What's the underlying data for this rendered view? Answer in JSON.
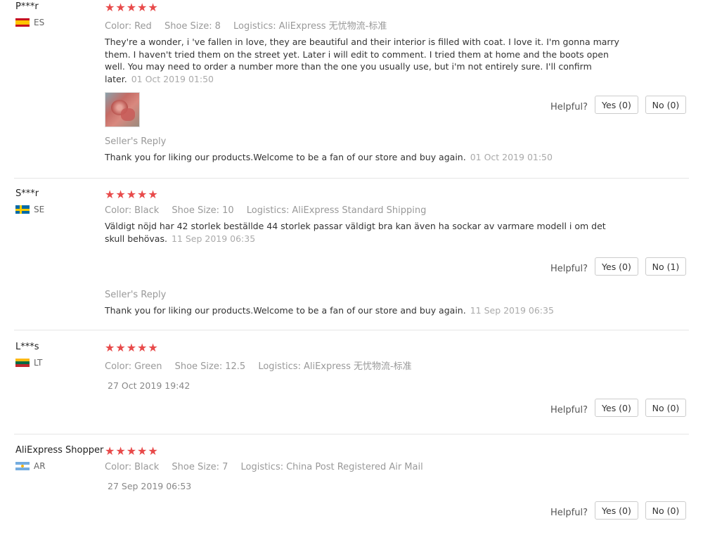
{
  "labels": {
    "color": "Color:",
    "shoe_size": "Shoe Size:",
    "logistics": "Logistics:",
    "helpful": "Helpful?",
    "seller_reply": "Seller's Reply"
  },
  "reviews": [
    {
      "user": "P***r",
      "country": "ES",
      "stars": "★★★★★",
      "color": "Red",
      "shoe_size": "8",
      "logistics": "AliExpress 无忧物流-标准",
      "text": "They're a wonder, i 've fallen in love, they are beautiful and their interior is filled with coat. I love it. I'm gonna marry them. I haven't tried them on the street yet. Later i will edit to comment. I tried them at home and the boots open well. You may need to order a number more than the one you usually use, but i'm not entirely sure. I'll confirm later.",
      "date": "01 Oct 2019 01:50",
      "yes": "Yes (0)",
      "no": "No (0)",
      "reply_text": "Thank you for liking our products.Welcome to be a fan of our store and buy again.",
      "reply_date": "01 Oct 2019 01:50"
    },
    {
      "user": "S***r",
      "country": "SE",
      "stars": "★★★★★",
      "color": "Black",
      "shoe_size": "10",
      "logistics": "AliExpress Standard Shipping",
      "text": "Väldigt nöjd har 42 storlek beställde 44 storlek passar väldigt bra kan även ha sockar av varmare modell i om det skull behövas.",
      "date": "11 Sep 2019 06:35",
      "yes": "Yes (0)",
      "no": "No (1)",
      "reply_text": "Thank you for liking our products.Welcome to be a fan of our store and buy again.",
      "reply_date": "11 Sep 2019 06:35"
    },
    {
      "user": "L***s",
      "country": "LT",
      "stars": "★★★★★",
      "color": "Green",
      "shoe_size": "12.5",
      "logistics": "AliExpress 无忧物流-标准",
      "date": "27 Oct 2019 19:42",
      "yes": "Yes (0)",
      "no": "No (0)"
    },
    {
      "user": "AliExpress Shopper",
      "country": "AR",
      "stars": "★★★★★",
      "color": "Black",
      "shoe_size": "7",
      "logistics": "China Post Registered Air Mail",
      "date": "27 Sep 2019 06:53",
      "yes": "Yes (0)",
      "no": "No (0)"
    }
  ],
  "flag_colors": {
    "ES": [
      "#c60b1e",
      "#ffc400"
    ],
    "SE": [
      "#006aa7",
      "#fecc00"
    ],
    "LT": [
      "#fdb913",
      "#006a44",
      "#c1272d"
    ],
    "AR": [
      "#74acdf",
      "#ffffff"
    ]
  }
}
